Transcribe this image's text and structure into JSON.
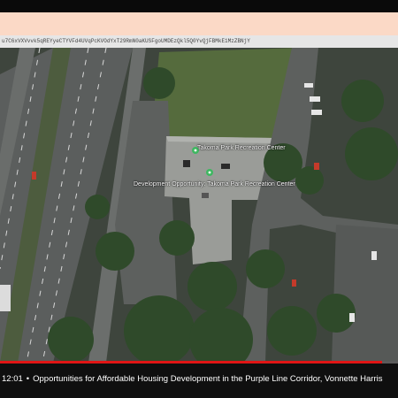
{
  "browser": {
    "url_fragment": "u7C6xVXVvvk5qREYyeCTYVFd4UVqPcKVOdYxT29RmN0aKUSFgoUMDEzQkl5Q0YvQjFBMkE1MzZBNjY"
  },
  "map": {
    "poi_name": "Takoma Park Recreation Center",
    "poi_subtitle": "Development Opportunity: Takoma Park Recreation Center",
    "colors": {
      "pin": "#3fb861",
      "roof": "#9a9c98",
      "tree": "#2f4a2a",
      "grass": "#556b3d",
      "road": "#5a5d5c"
    }
  },
  "player": {
    "progress_fraction": 0.96,
    "timecode": "12:01",
    "separator": "•",
    "title": "Opportunities for Affordable Housing Development in the Purple Line Corridor, Vonnette Harris",
    "progress_color": "#e01515"
  }
}
